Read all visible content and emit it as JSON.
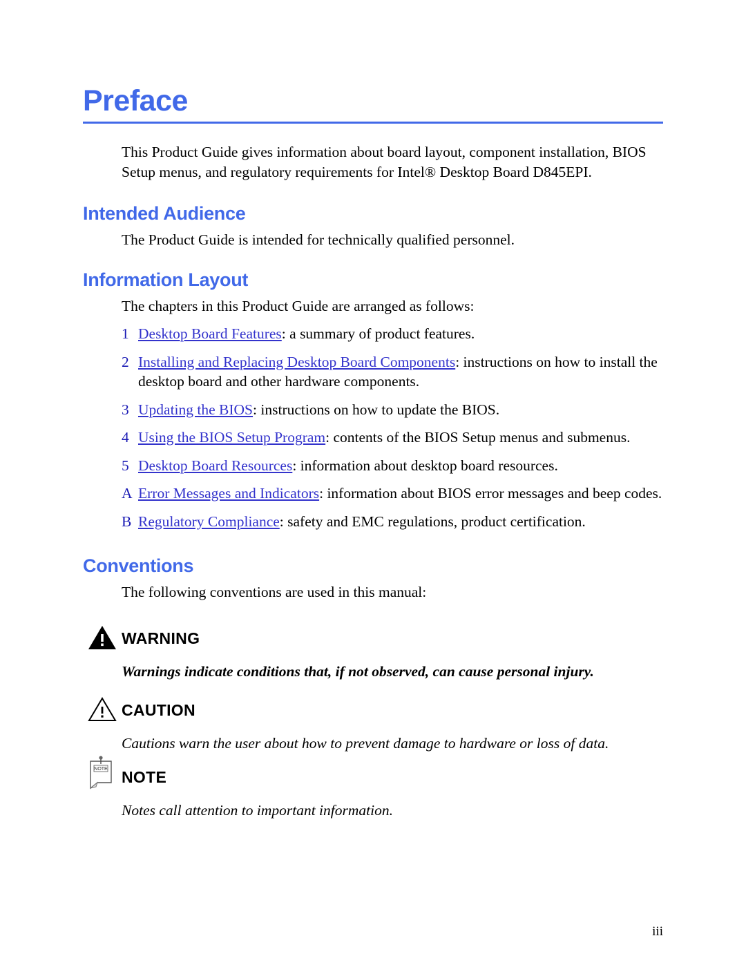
{
  "document": {
    "title": "Preface",
    "page_number": "iii",
    "accent_color": "#4169E8",
    "link_color": "#3333cc",
    "marker_color": "#1a1ab4",
    "text_color": "#000000"
  },
  "intro": {
    "paragraph": "This Product Guide gives information about board layout, component installation, BIOS Setup menus, and regulatory requirements for Intel® Desktop Board D845EPI."
  },
  "sections": {
    "intended_audience": {
      "heading": "Intended Audience",
      "paragraph": "The Product Guide is intended for technically qualified personnel."
    },
    "information_layout": {
      "heading": "Information Layout",
      "paragraph": "The chapters in this Product Guide are arranged as follows:",
      "chapters": [
        {
          "marker": "1",
          "link": "Desktop Board Features",
          "description": ":  a summary of product features."
        },
        {
          "marker": "2",
          "link": "Installing and Replacing Desktop Board Components",
          "description": ":  instructions on how to install the desktop board and other hardware components."
        },
        {
          "marker": "3",
          "link": "Updating the BIOS",
          "description": ":  instructions on how to update the BIOS."
        },
        {
          "marker": "4",
          "link": "Using the BIOS Setup Program",
          "description": ":  contents of the BIOS Setup menus and submenus."
        },
        {
          "marker": "5",
          "link": "Desktop Board Resources",
          "description": ":  information about desktop board resources."
        },
        {
          "marker": "A",
          "link": "Error Messages and Indicators",
          "description": ":  information about BIOS error messages and beep codes."
        },
        {
          "marker": "B",
          "link": "Regulatory Compliance",
          "description": ":  safety and EMC regulations, product certification."
        }
      ]
    },
    "conventions": {
      "heading": "Conventions",
      "paragraph": "The following conventions are used in this manual:",
      "items": [
        {
          "icon": "warning-triangle-icon",
          "label": "WARNING",
          "text": "Warnings indicate conditions that, if not observed, can cause personal injury."
        },
        {
          "icon": "caution-triangle-icon",
          "label": "CAUTION",
          "text": "Cautions warn the user about how to prevent damage to hardware or loss of data."
        },
        {
          "icon": "note-pad-icon",
          "label": "NOTE",
          "icon_text": "NOTE",
          "text": "Notes call attention to important information."
        }
      ]
    }
  }
}
